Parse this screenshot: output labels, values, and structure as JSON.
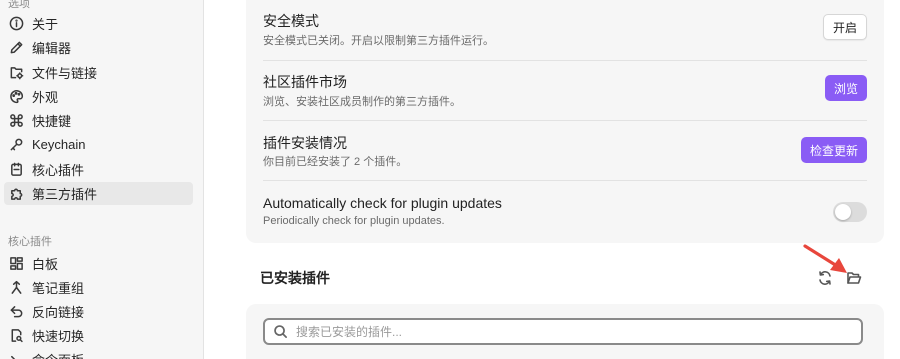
{
  "sidebar": {
    "options_header": "选项",
    "options_items": [
      {
        "label": "关于",
        "icon": "info-icon"
      },
      {
        "label": "编辑器",
        "icon": "pencil-icon"
      },
      {
        "label": "文件与链接",
        "icon": "folder-cog-icon"
      },
      {
        "label": "外观",
        "icon": "palette-icon"
      },
      {
        "label": "快捷键",
        "icon": "command-icon"
      },
      {
        "label": "Keychain",
        "icon": "key-icon"
      },
      {
        "label": "核心插件",
        "icon": "plug-icon"
      },
      {
        "label": "第三方插件",
        "icon": "puzzle-icon",
        "active": true
      }
    ],
    "core_header": "核心插件",
    "core_items": [
      {
        "label": "白板",
        "icon": "layout-dashboard-icon"
      },
      {
        "label": "笔记重组",
        "icon": "merge-icon"
      },
      {
        "label": "反向链接",
        "icon": "backlink-icon"
      },
      {
        "label": "快速切换",
        "icon": "file-search-icon"
      },
      {
        "label": "命令面板",
        "icon": "terminal-icon"
      }
    ]
  },
  "settings": [
    {
      "name": "安全模式",
      "desc": "安全模式已关闭。开启以限制第三方插件运行。",
      "control": "button",
      "label": "开启",
      "style": "plain"
    },
    {
      "name": "社区插件市场",
      "desc": "浏览、安装社区成员制作的第三方插件。",
      "control": "button",
      "label": "浏览",
      "style": "accent"
    },
    {
      "name": "插件安装情况",
      "desc": "你目前已经安装了 2 个插件。",
      "control": "button",
      "label": "检查更新",
      "style": "accent"
    },
    {
      "name": "Automatically check for plugin updates",
      "desc": "Periodically check for plugin updates.",
      "control": "toggle",
      "checked": false
    }
  ],
  "installed": {
    "heading": "已安装插件",
    "reload_icon": "reload-icon",
    "open_folder_icon": "folder-open-icon",
    "search_placeholder": "搜索已安装的插件..."
  },
  "colors": {
    "accent": "#8a5cf5",
    "annotation_arrow": "#e8463c"
  }
}
